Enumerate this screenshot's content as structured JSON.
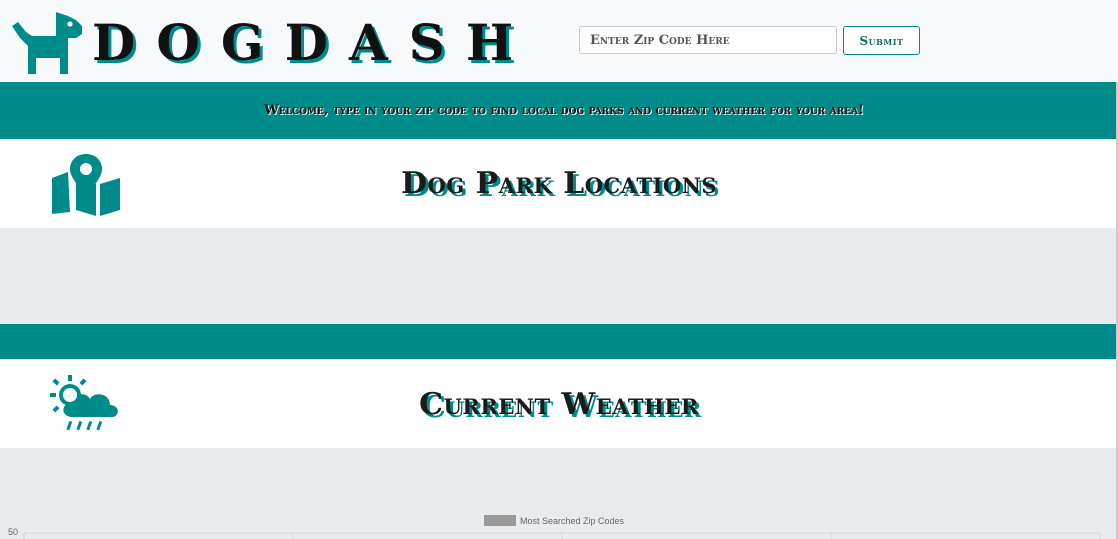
{
  "header": {
    "logo_text": "DOGDASH",
    "search": {
      "placeholder": "Enter Zip Code Here",
      "value": ""
    },
    "submit_label": "Submit"
  },
  "banner": {
    "text": "Welcome, type in your zip code to find local dog parks and current weather for your area!"
  },
  "parks": {
    "title": "Dog Park Locations",
    "icon": "map-marker-icon"
  },
  "weather": {
    "title": "Current Weather",
    "icon": "sun-cloud-rain-icon"
  },
  "colors": {
    "accent": "#008b8b",
    "header_bg": "#f8f9fa",
    "section_bg": "#e9ecef",
    "title_text": "#1b1b1b"
  },
  "chart_data": {
    "type": "bar",
    "series": [
      {
        "name": "Most Searched Zip Codes",
        "values": []
      }
    ],
    "categories": [],
    "y_tick_labels": [
      "50"
    ],
    "ylim": [
      0,
      50
    ],
    "grid": true,
    "legend": "top-center"
  }
}
